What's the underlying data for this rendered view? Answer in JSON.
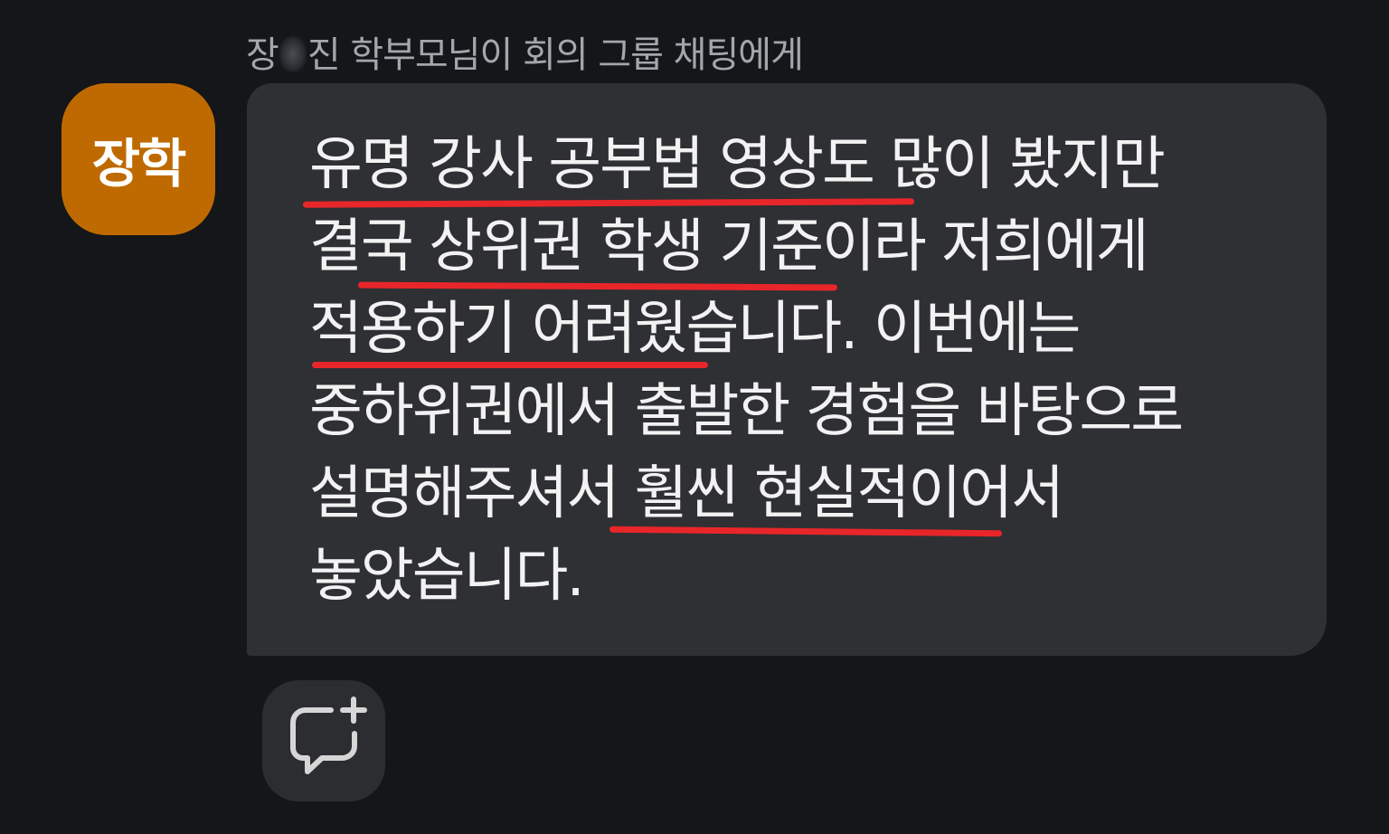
{
  "header": {
    "sender_prefix": "장",
    "sender_suffix": "진 학부모님이 회의 그룹 채팅에게"
  },
  "avatar": {
    "label": "장학",
    "color": "#bf6a00"
  },
  "message": {
    "lines": [
      "유명 강사 공부법 영상도 많이 봤지만",
      "결국 상위권 학생 기준이라 저희에게",
      "적용하기 어려웠습니다. 이번에는",
      "중하위권에서 출발한 경험을 바탕으로",
      "설명해주셔서 훨씬 현실적이어서",
      "놓았습니다."
    ],
    "underline_color": "#e8262a",
    "bubble_color": "#2f3033"
  },
  "actions": {
    "add_reaction_icon": "comment-plus-icon"
  }
}
